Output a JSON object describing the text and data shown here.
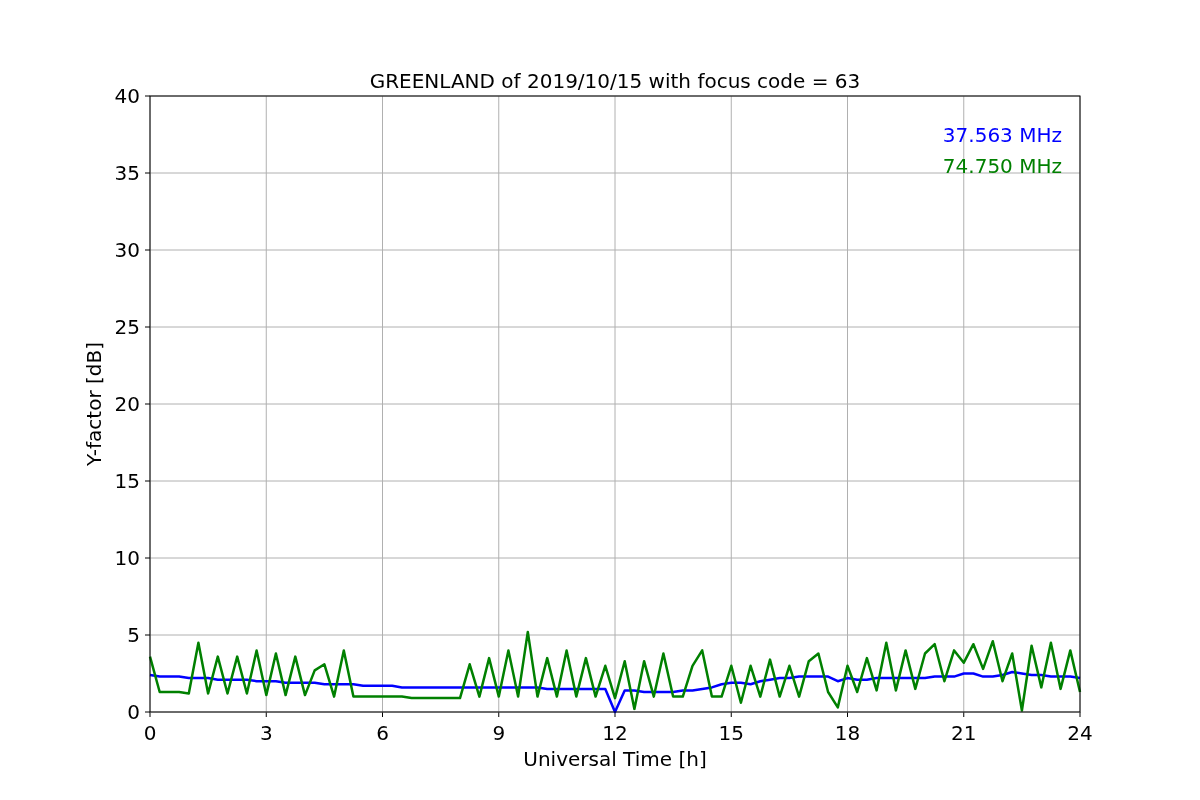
{
  "chart": {
    "chart_data": {
      "type": "line",
      "title": "GREENLAND of 2019/10/15 with focus code = 63",
      "xlabel": "Universal Time [h]",
      "ylabel": "Y-factor [dB]",
      "x": [
        0,
        0.25,
        0.5,
        0.75,
        1,
        1.25,
        1.5,
        1.75,
        2,
        2.25,
        2.5,
        2.75,
        3,
        3.25,
        3.5,
        3.75,
        4,
        4.25,
        4.5,
        4.75,
        5,
        5.25,
        5.5,
        5.75,
        6,
        6.25,
        6.5,
        6.75,
        7,
        7.25,
        7.5,
        7.75,
        8,
        8.25,
        8.5,
        8.75,
        9,
        9.25,
        9.5,
        9.75,
        10,
        10.25,
        10.5,
        10.75,
        11,
        11.25,
        11.5,
        11.75,
        12,
        12.25,
        12.5,
        12.75,
        13,
        13.25,
        13.5,
        13.75,
        14,
        14.25,
        14.5,
        14.75,
        15,
        15.25,
        15.5,
        15.75,
        16,
        16.25,
        16.5,
        16.75,
        17,
        17.25,
        17.5,
        17.75,
        18,
        18.25,
        18.5,
        18.75,
        19,
        19.25,
        19.5,
        19.75,
        20,
        20.25,
        20.5,
        20.75,
        21,
        21.25,
        21.5,
        21.75,
        22,
        22.25,
        22.5,
        22.75,
        23,
        23.25,
        23.5,
        23.75,
        24
      ],
      "series": [
        {
          "name": "37.563 MHz",
          "color": "#0000ff",
          "values": [
            2.4,
            2.3,
            2.3,
            2.3,
            2.2,
            2.2,
            2.2,
            2.1,
            2.1,
            2.1,
            2.1,
            2.0,
            2.0,
            2.0,
            1.9,
            1.9,
            1.9,
            1.9,
            1.8,
            1.8,
            1.8,
            1.8,
            1.7,
            1.7,
            1.7,
            1.7,
            1.6,
            1.6,
            1.6,
            1.6,
            1.6,
            1.6,
            1.6,
            1.6,
            1.6,
            1.6,
            1.6,
            1.6,
            1.6,
            1.6,
            1.6,
            1.5,
            1.5,
            1.5,
            1.5,
            1.5,
            1.5,
            1.5,
            0,
            1.4,
            1.4,
            1.3,
            1.3,
            1.3,
            1.3,
            1.4,
            1.4,
            1.5,
            1.6,
            1.8,
            1.9,
            1.9,
            1.8,
            2.0,
            2.1,
            2.2,
            2.2,
            2.3,
            2.3,
            2.3,
            2.3,
            2.0,
            2.2,
            2.1,
            2.1,
            2.2,
            2.2,
            2.2,
            2.2,
            2.2,
            2.2,
            2.3,
            2.3,
            2.3,
            2.5,
            2.5,
            2.3,
            2.3,
            2.4,
            2.6,
            2.5,
            2.4,
            2.4,
            2.3,
            2.3,
            2.3,
            2.2
          ]
        },
        {
          "name": "74.750 MHz",
          "color": "#008000",
          "values": [
            3.6,
            1.3,
            1.3,
            1.3,
            1.2,
            4.5,
            1.2,
            3.6,
            1.2,
            3.6,
            1.2,
            4.0,
            1.1,
            3.8,
            1.1,
            3.6,
            1.1,
            2.7,
            3.1,
            1.0,
            4.0,
            1.0,
            1.0,
            1.0,
            1.0,
            1.0,
            1.0,
            0.9,
            0.9,
            0.9,
            0.9,
            0.9,
            0.9,
            3.1,
            1.0,
            3.5,
            1.0,
            4.0,
            1.0,
            5.2,
            1.0,
            3.5,
            1.0,
            4.0,
            1.0,
            3.5,
            1.0,
            3.0,
            0.9,
            3.3,
            0.2,
            3.3,
            1.0,
            3.8,
            1.0,
            1.0,
            3.0,
            4.0,
            1.0,
            1.0,
            3.0,
            0.6,
            3.0,
            1.0,
            3.4,
            1.0,
            3.0,
            1.0,
            3.3,
            3.8,
            1.3,
            0.3,
            3.0,
            1.3,
            3.5,
            1.4,
            4.5,
            1.4,
            4.0,
            1.5,
            3.8,
            4.4,
            2.0,
            4.0,
            3.2,
            4.4,
            2.8,
            4.6,
            2.0,
            3.8,
            0.1,
            4.3,
            1.6,
            4.5,
            1.5,
            4.0,
            1.3
          ]
        }
      ],
      "xlim": [
        0,
        24
      ],
      "ylim": [
        0,
        40
      ],
      "xticks": [
        0,
        3,
        6,
        9,
        12,
        15,
        18,
        21,
        24
      ],
      "yticks": [
        0,
        5,
        10,
        15,
        20,
        25,
        30,
        35,
        40
      ],
      "grid": true
    }
  }
}
